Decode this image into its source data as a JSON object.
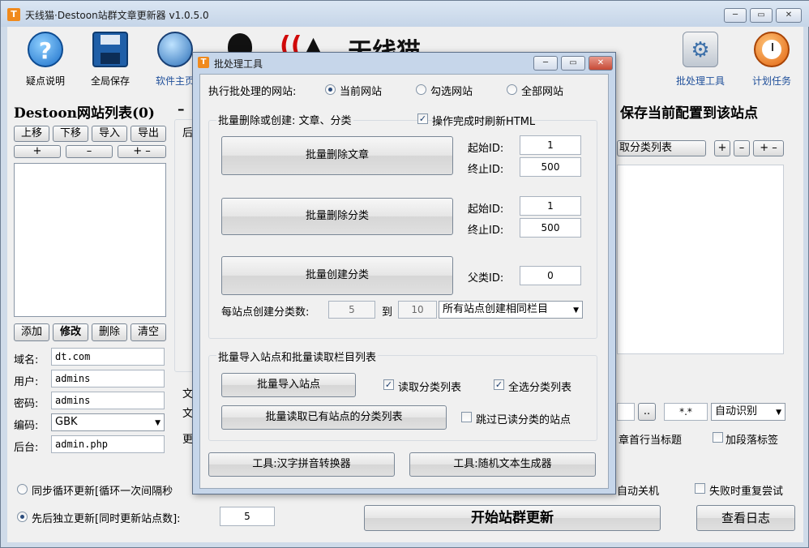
{
  "app": {
    "title": "天线猫·Destoon站群文章更新器 v1.0.5.0",
    "icon_glyph": "T",
    "caption": {
      "min": "─",
      "max": "▭",
      "close": "✕"
    }
  },
  "toolbar": {
    "help_label": "疑点说明",
    "save_label": "全局保存",
    "home_label": "软件主页",
    "batch_label": "批处理工具",
    "schedule_label": "计划任务",
    "help_glyph": "?",
    "batch_glyph": "⚙"
  },
  "logo": {
    "mark": "((",
    "cat": "▲",
    "text": "天线猫"
  },
  "left": {
    "heading": "Destoon网站列表(0)",
    "heading_dash": "–",
    "up": "上移",
    "down": "下移",
    "import": "导入",
    "export": "导出",
    "plus": "+",
    "minus": "–",
    "plusminus": "+ –",
    "add": "添加",
    "edit": "修改",
    "delete": "删除",
    "clear": "清空",
    "domain_label": "域名:",
    "domain_value": "dt.com",
    "user_label": "用户:",
    "user_value": "admins",
    "pass_label": "密码:",
    "pass_value": "admins",
    "enc_label": "编码:",
    "enc_value": "GBK",
    "admin_label": "后台:",
    "admin_value": "admin.php"
  },
  "right": {
    "save_config": "保存当前配置到该站点",
    "fetch_categories": "取分类列表",
    "plus": "+",
    "minus": "–",
    "plusminus": "+ –",
    "browse": "..",
    "pattern": "*.*",
    "detect": "自动识别",
    "first_line_title": "章首行当标题",
    "add_paragraph_tags": "加段落标签",
    "partial_hou": "后",
    "partial_wen1": "文",
    "partial_wen2": "文",
    "partial_geng": "更"
  },
  "bottom": {
    "sync_loop": "同步循环更新[循环一次间隔秒",
    "sequential": "先后独立更新[同时更新站点数]:",
    "concurrency": "5",
    "auto_shutdown": "自动关机",
    "retry_on_fail": "失败时重复尝试",
    "start": "开始站群更新",
    "view_log": "查看日志"
  },
  "dialog": {
    "title": "批处理工具",
    "execute_label": "执行批处理的网站:",
    "scope_current": "当前网站",
    "scope_checked": "勾选网站",
    "scope_all": "全部网站",
    "group1_title": "批量删除或创建: 文章、分类",
    "refresh_html": "操作完成时刷新HTML",
    "delete_articles": "批量删除文章",
    "delete_categories": "批量删除分类",
    "create_categories": "批量创建分类",
    "start_id_label": "起始ID:",
    "end_id_label": "终止ID:",
    "art_start": "1",
    "art_end": "500",
    "cat_start": "1",
    "cat_end": "500",
    "parent_label": "父类ID:",
    "parent_value": "0",
    "per_site_label": "每站点创建分类数:",
    "per_site_from": "5",
    "to_label": "到",
    "per_site_to": "10",
    "same_column": "所有站点创建相同栏目",
    "group2_title": "批量导入站点和批量读取栏目列表",
    "import_sites": "批量导入站点",
    "read_cat_list": "读取分类列表",
    "select_all_cats": "全选分类列表",
    "batch_read": "批量读取已有站点的分类列表",
    "skip_read": "跳过已读分类的站点",
    "pinyin_tool": "工具:汉字拼音转换器",
    "random_text_tool": "工具:随机文本生成器"
  },
  "colors": {
    "title_bar": "#c5d5e8",
    "logo_red": "#d10a0a",
    "accent_orange": "#f08a1d"
  }
}
